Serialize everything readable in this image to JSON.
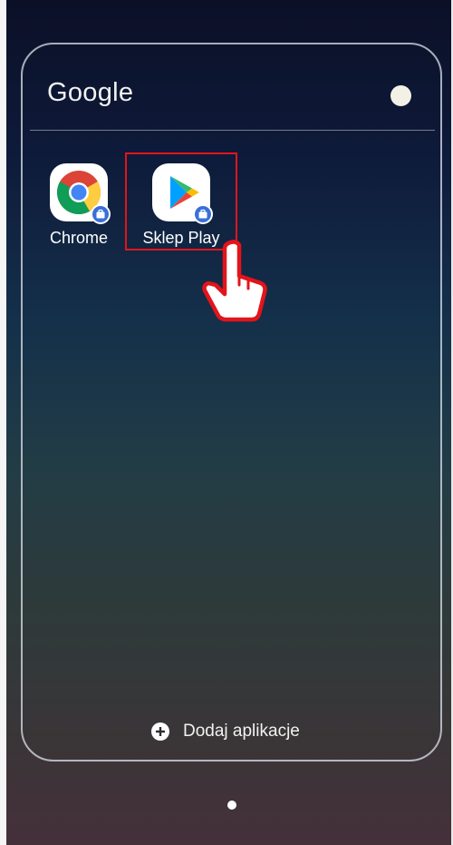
{
  "folder": {
    "title": "Google",
    "color_dot": "#f3f0e6",
    "apps": [
      {
        "label": "Chrome",
        "icon": "chrome-icon",
        "badge": "work-briefcase-icon"
      },
      {
        "label": "Sklep Play",
        "icon": "play-store-icon",
        "badge": "work-briefcase-icon"
      }
    ],
    "add_apps_label": "Dodaj aplikacje",
    "add_apps_icon": "plus-circle-icon"
  },
  "annotation": {
    "highlight_color": "#e3141a",
    "pointer_icon": "hand-pointer-icon",
    "target": "Sklep Play"
  },
  "page_indicator": {
    "pages": 1,
    "current": 1
  }
}
